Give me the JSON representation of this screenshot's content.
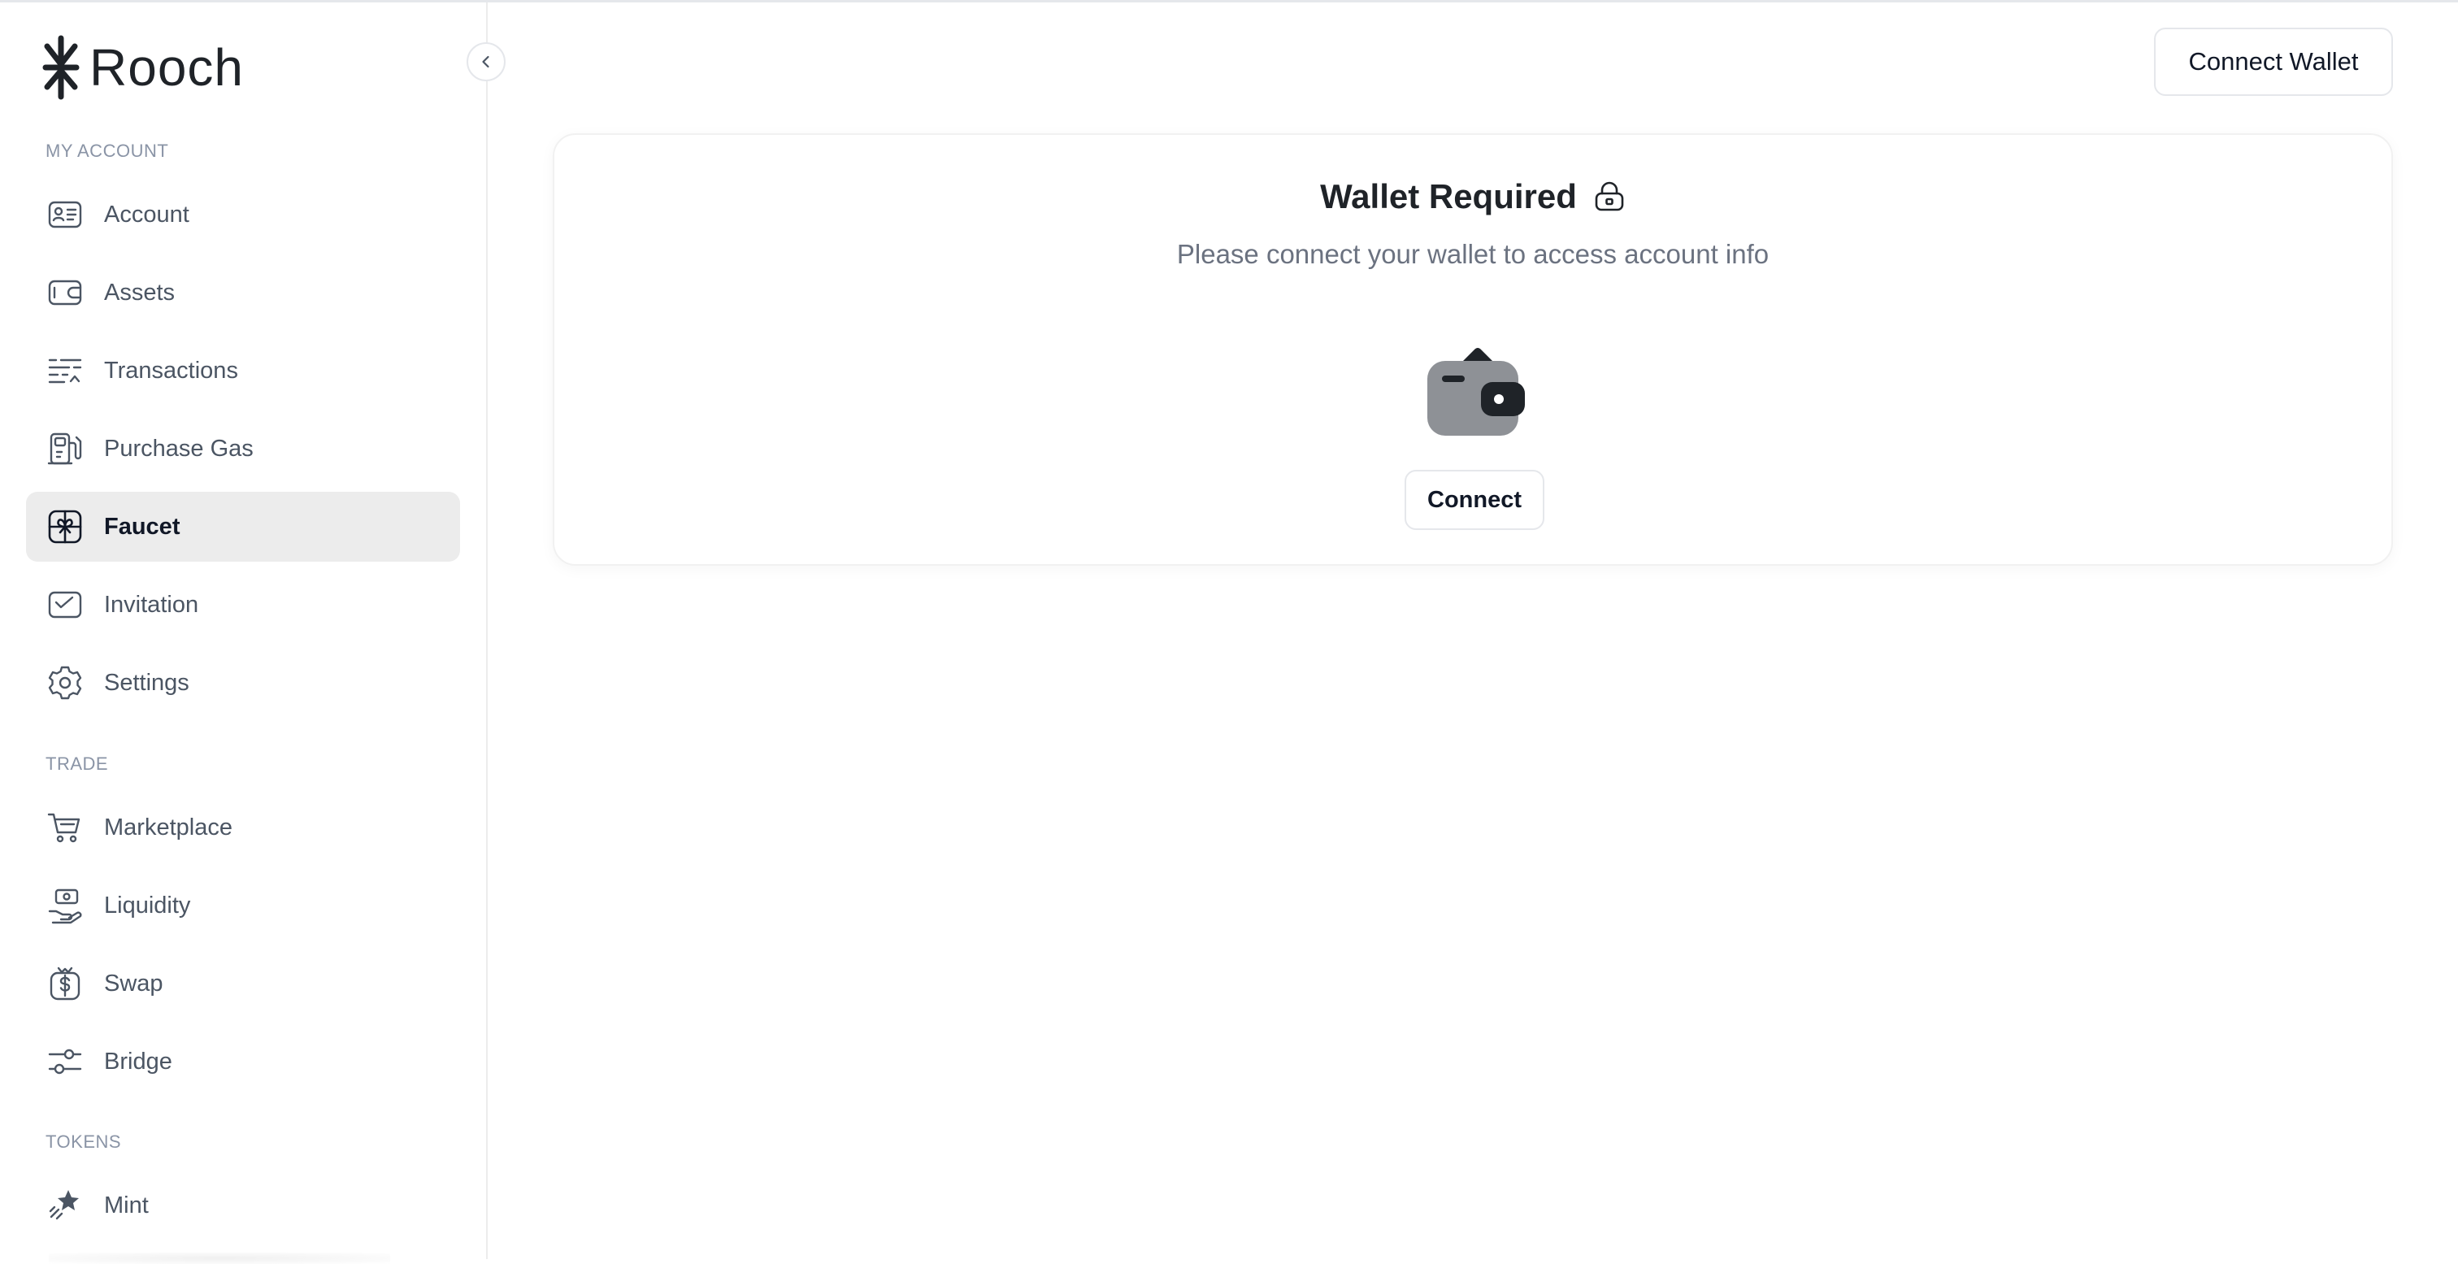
{
  "brand": {
    "name": "Rooch"
  },
  "sidebar": {
    "sections": [
      {
        "title": "MY ACCOUNT",
        "items": [
          {
            "label": "Account",
            "icon": "id-card-icon"
          },
          {
            "label": "Assets",
            "icon": "wallet-icon"
          },
          {
            "label": "Transactions",
            "icon": "transactions-icon"
          },
          {
            "label": "Purchase Gas",
            "icon": "gas-station-icon"
          },
          {
            "label": "Faucet",
            "icon": "gift-icon",
            "active": true
          },
          {
            "label": "Invitation",
            "icon": "mail-icon"
          },
          {
            "label": "Settings",
            "icon": "gear-icon"
          }
        ]
      },
      {
        "title": "TRADE",
        "items": [
          {
            "label": "Marketplace",
            "icon": "cart-icon"
          },
          {
            "label": "Liquidity",
            "icon": "liquidity-icon"
          },
          {
            "label": "Swap",
            "icon": "swap-icon"
          },
          {
            "label": "Bridge",
            "icon": "bridge-icon"
          }
        ]
      },
      {
        "title": "TOKENS",
        "items": [
          {
            "label": "Mint",
            "icon": "mint-star-icon"
          }
        ]
      }
    ]
  },
  "header": {
    "connect_wallet_label": "Connect Wallet"
  },
  "main": {
    "title": "Wallet Required",
    "subtitle": "Please connect your wallet to access account info",
    "connect_label": "Connect"
  },
  "colors": {
    "active_bg": "#ececec",
    "section_title": "#8a94a6",
    "nav_text": "#4b5563",
    "wallet_body": "#8e9196",
    "wallet_dark": "#1f2328"
  }
}
